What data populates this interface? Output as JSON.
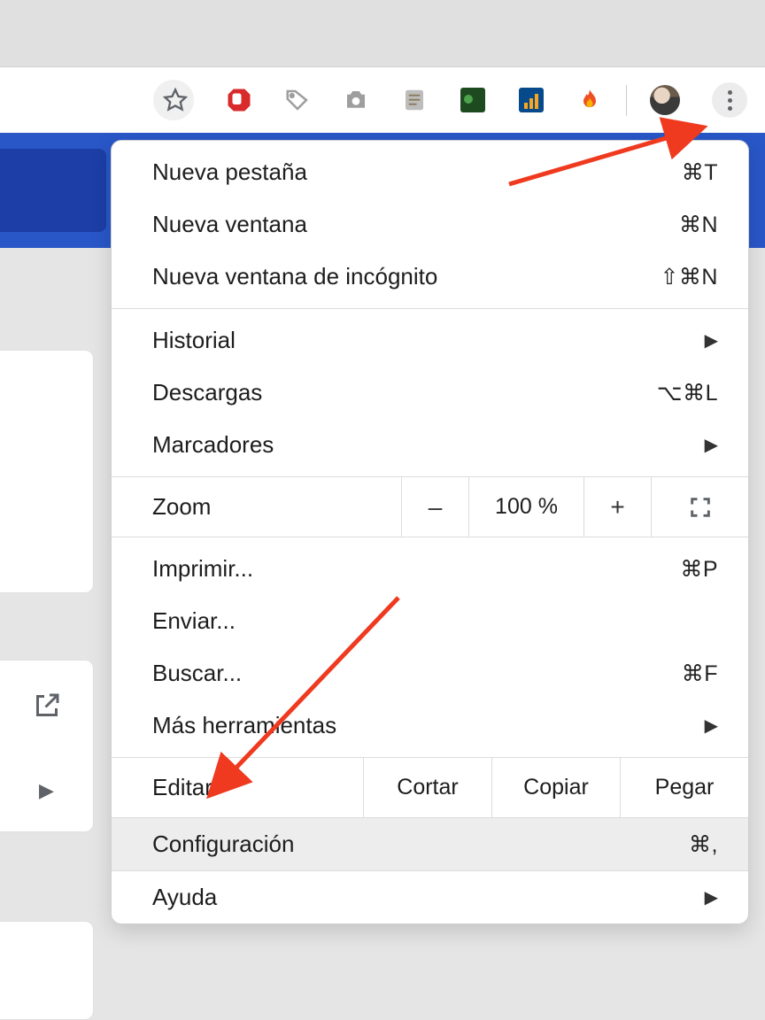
{
  "menu": {
    "group1": [
      {
        "label": "Nueva pestaña",
        "shortcut": "⌘T"
      },
      {
        "label": "Nueva ventana",
        "shortcut": "⌘N"
      },
      {
        "label": "Nueva ventana de incógnito",
        "shortcut": "⇧⌘N"
      }
    ],
    "group2": [
      {
        "label": "Historial",
        "submenu": true
      },
      {
        "label": "Descargas",
        "shortcut": "⌥⌘L"
      },
      {
        "label": "Marcadores",
        "submenu": true
      }
    ],
    "zoom": {
      "label": "Zoom",
      "minus": "–",
      "value": "100 %",
      "plus": "+"
    },
    "group3": [
      {
        "label": "Imprimir...",
        "shortcut": "⌘P"
      },
      {
        "label": "Enviar..."
      },
      {
        "label": "Buscar...",
        "shortcut": "⌘F"
      },
      {
        "label": "Más herramientas",
        "submenu": true
      }
    ],
    "edit": {
      "label": "Editar",
      "cut": "Cortar",
      "copy": "Copiar",
      "paste": "Pegar"
    },
    "group4": [
      {
        "label": "Configuración",
        "shortcut": "⌘,",
        "highlight": true
      },
      {
        "label": "Ayuda",
        "submenu": true
      }
    ]
  }
}
